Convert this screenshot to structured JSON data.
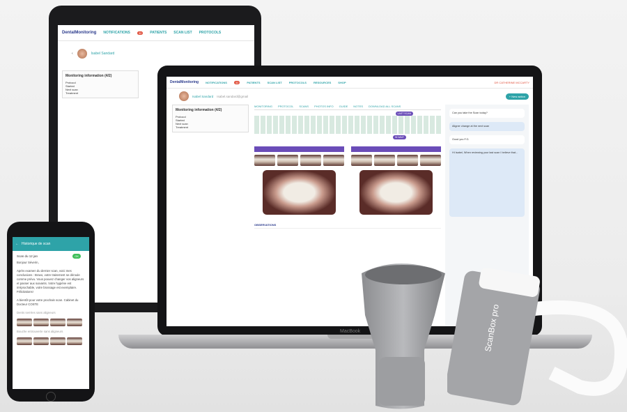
{
  "brand": {
    "name": "DentalMonitoring",
    "accent": "#2ea3a8",
    "brand_color": "#2a3a8c",
    "alert": "#e0503c",
    "scan_color": "#6a4cb8"
  },
  "nav": {
    "items": [
      "NOTIFICATIONS",
      "PATIENTS",
      "SCAN LIST",
      "PROTOCOLS",
      "RESOURCES",
      "SHOP"
    ],
    "badge": "32",
    "user": "DR CATHERINE MCCARTY"
  },
  "patient": {
    "name": "Isabel Sandard",
    "sub": "Isabel.sandard@gmail"
  },
  "monitoring": {
    "title": "Monitoring information (4/2)",
    "rows": [
      "Protocol",
      "Started",
      "Next scan",
      "Treatment"
    ]
  },
  "laptop": {
    "tabs": [
      "MONITORING",
      "PROTOCOL",
      "SCANS",
      "PHOTOS INFO",
      "GUIDE",
      "NOTES",
      "DOWNLOAD ALL SCANS"
    ],
    "scan_pill": "LAST SCAN",
    "scan_pill2": "IN WAIT",
    "observations_label": "OBSERVATIONS",
    "button": "+ New action",
    "chat": [
      "Can you take the Scan today?",
      "Aligner change at the next scan",
      "Good you F.G.",
      "Hi Isabel, When reviewing your last scan I believe that..."
    ]
  },
  "phone": {
    "header": "Historique de scan",
    "time": "Scan du 12 jan",
    "status": "OK",
    "greeting": "Bonjour Séverin,",
    "body": "Après examen du dernier scan, voici mes conclusions : Bravo, votre traitement se déroule comme prévu. Vous pouvez changer vos aligneurs et passer aux suivants. Votre hygiène est irréprochable, votre brossage est exemplaire. Félicitations!",
    "sign": "A bientôt pour votre prochain scan. Cabinet du Docteur COSTE",
    "section1": "Dents serrées sans aligneurs",
    "section2": "Bouche entrouverte sans aligneurs"
  },
  "devices": {
    "scanbox_text": "ScanBox pro",
    "laptop_label": "MacBook"
  }
}
